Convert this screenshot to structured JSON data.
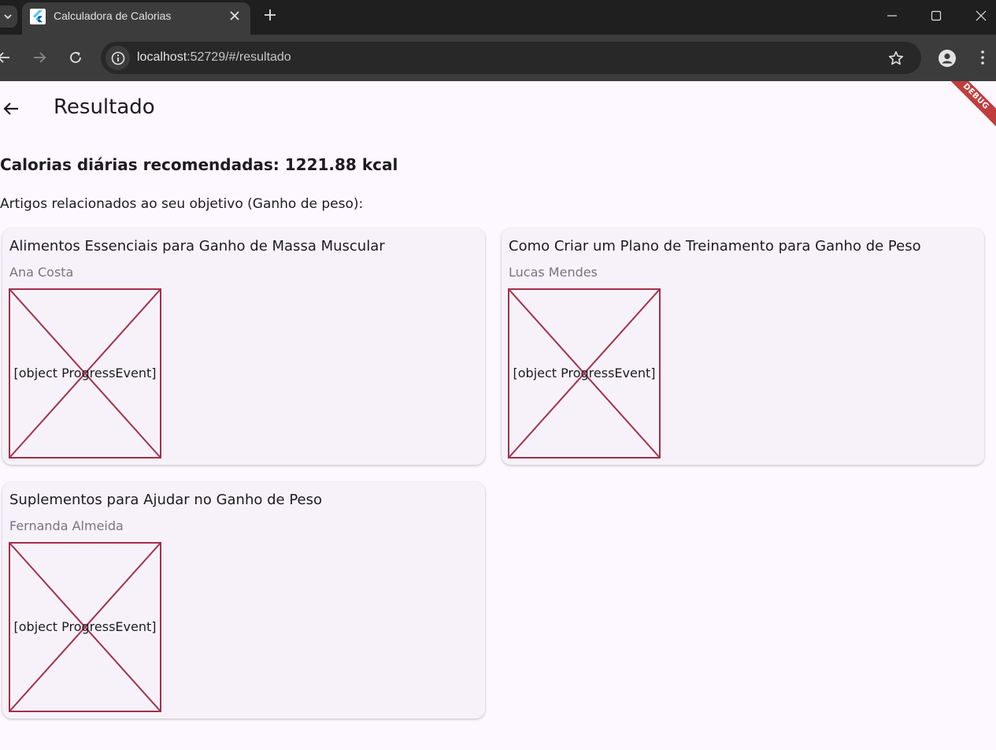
{
  "browser": {
    "tab_title": "Calculadora de Calorias",
    "url_host": "localhost",
    "url_rest": ":52729/#/resultado"
  },
  "app": {
    "page_title": "Resultado",
    "debug_banner": "DEBUG",
    "calories_text": "Calorias diárias recomendadas: 1221.88 kcal",
    "articles_heading": "Artigos relacionados ao seu objetivo (Ganho de peso):",
    "articles": [
      {
        "title": "Alimentos Essenciais para Ganho de Massa Muscular",
        "author": "Ana Costa",
        "image_error": "[object ProgressEvent]"
      },
      {
        "title": "Como Criar um Plano de Treinamento para Ganho de Peso",
        "author": "Lucas Mendes",
        "image_error": "[object ProgressEvent]"
      },
      {
        "title": "Suplementos para Ajudar no Ganho de Peso",
        "author": "Fernanda Almeida",
        "image_error": "[object ProgressEvent]"
      }
    ]
  },
  "colors": {
    "background": "#fdf7ff",
    "card": "#f7f2fa",
    "broken_image_stroke": "#a4304a",
    "debug_banner": "#b71c1c"
  }
}
